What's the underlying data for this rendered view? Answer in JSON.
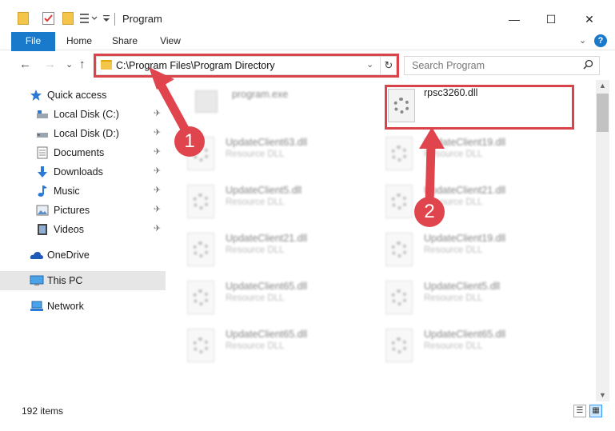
{
  "window": {
    "title": "Program",
    "minimize": "—",
    "maximize": "☐",
    "close": "✕"
  },
  "ribbon": {
    "tabs": [
      "File",
      "Home",
      "Share",
      "View"
    ],
    "expand": "⌄",
    "help": "?"
  },
  "nav": {
    "back": "←",
    "forward": "→",
    "recent": "⌄",
    "up": "↑",
    "address": "C:\\Program Files\\Program Directory",
    "address_dropdown": "⌄",
    "refresh": "↻",
    "search_placeholder": "Search Program",
    "search_icon": "⌕"
  },
  "sidebar": {
    "items": [
      {
        "label": "Quick access",
        "icon": "star-icon",
        "pinned": false
      },
      {
        "label": "Local Disk (C:)",
        "icon": "drive-icon",
        "pinned": true
      },
      {
        "label": "Local Disk (D:)",
        "icon": "drive-icon",
        "pinned": true
      },
      {
        "label": "Documents",
        "icon": "documents-icon",
        "pinned": true
      },
      {
        "label": "Downloads",
        "icon": "download-icon",
        "pinned": true
      },
      {
        "label": "Music",
        "icon": "music-icon",
        "pinned": true
      },
      {
        "label": "Pictures",
        "icon": "pictures-icon",
        "pinned": true
      },
      {
        "label": "Videos",
        "icon": "videos-icon",
        "pinned": true
      },
      {
        "label": "OneDrive",
        "icon": "cloud-icon",
        "pinned": false
      },
      {
        "label": "This PC",
        "icon": "computer-icon",
        "pinned": false
      },
      {
        "label": "Network",
        "icon": "network-icon",
        "pinned": false
      }
    ],
    "pin_glyph": "📌"
  },
  "files": [
    {
      "name": "program.exe",
      "desc": "",
      "type": "exe",
      "blurred": true
    },
    {
      "name": "rpsc3260.dll",
      "desc": "",
      "type": "dll",
      "blurred": false
    },
    {
      "name": "UpdateClient63.dll",
      "desc": "Resource DLL",
      "type": "dll",
      "blurred": true
    },
    {
      "name": "UpdateClient19.dll",
      "desc": "Resource DLL",
      "type": "dll",
      "blurred": true
    },
    {
      "name": "UpdateClient5.dll",
      "desc": "Resource DLL",
      "type": "dll",
      "blurred": true
    },
    {
      "name": "UpdateClient21.dll",
      "desc": "Resource DLL",
      "type": "dll",
      "blurred": true
    },
    {
      "name": "UpdateClient21.dll",
      "desc": "Resource DLL",
      "type": "dll",
      "blurred": true
    },
    {
      "name": "UpdateClient19.dll",
      "desc": "Resource DLL",
      "type": "dll",
      "blurred": true
    },
    {
      "name": "UpdateClient65.dll",
      "desc": "Resource DLL",
      "type": "dll",
      "blurred": true
    },
    {
      "name": "UpdateClient5.dll",
      "desc": "Resource DLL",
      "type": "dll",
      "blurred": true
    },
    {
      "name": "UpdateClient65.dll",
      "desc": "Resource DLL",
      "type": "dll",
      "blurred": true
    },
    {
      "name": "UpdateClient65.dll",
      "desc": "Resource DLL",
      "type": "dll",
      "blurred": true
    }
  ],
  "status": {
    "items": "192 items",
    "details_view": "☰",
    "icons_view": "▦"
  },
  "annotations": {
    "callout1": "1",
    "callout2": "2"
  },
  "colors": {
    "accent": "#1979ca",
    "annotation_red": "#d9434a",
    "selected": "#e6e6e6"
  }
}
